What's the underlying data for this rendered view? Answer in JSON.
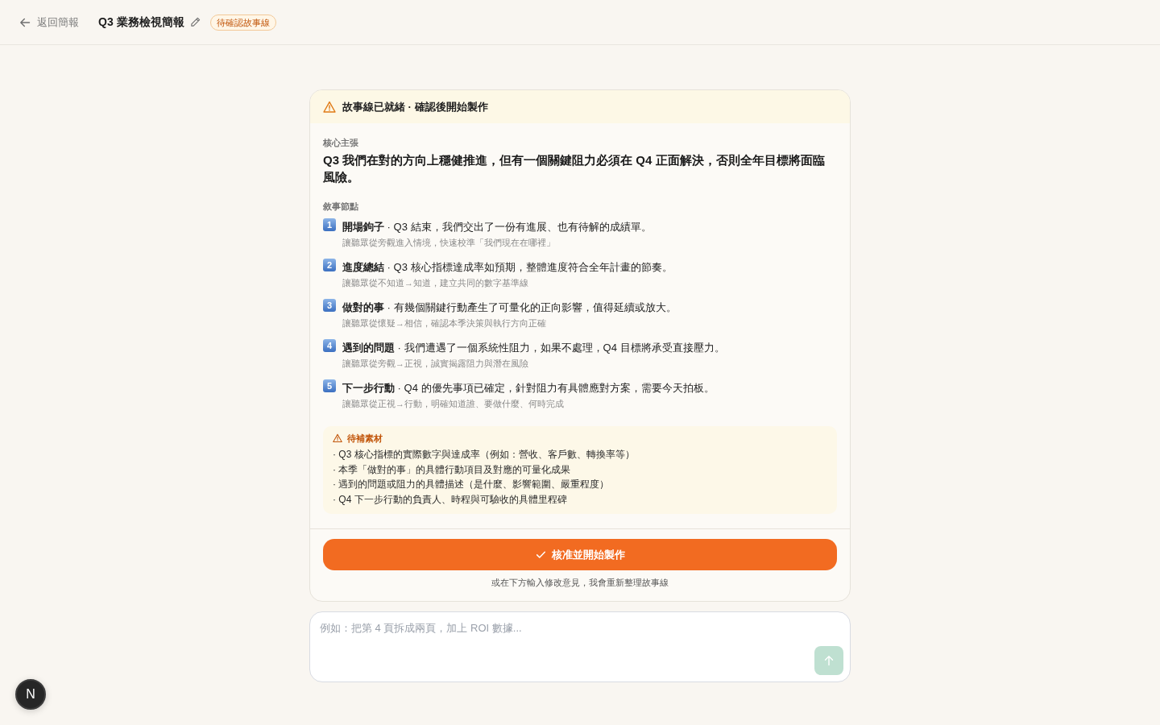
{
  "top_bar": {
    "back_link": "返回簡報",
    "title": "Q3 業務檢視簡報",
    "status_badge": "待確認故事線"
  },
  "storyline_card": {
    "banner": "故事線已就緒 · 確認後開始製作",
    "core_claim": {
      "label": "核心主張",
      "text": "Q3 我們在對的方向上穩健推進，但有一個關鍵阻力必須在 Q4 正面解決，否則全年目標將面臨風險。"
    },
    "narrative_nodes": {
      "label": "敘事節點",
      "items": [
        {
          "number": "1",
          "line": "**開場鉤子** · Q3 結束，我們交出了一份有進展、也有待解的成績單。",
          "goal": "讓聽眾從旁觀進入情境，快速校準「我們現在在哪裡」"
        },
        {
          "number": "2",
          "line": "**進度總結** · Q3 核心指標達成率如預期，整體進度符合全年計畫的節奏。",
          "goal": "讓聽眾從不知道→知道，建立共同的數字基準線"
        },
        {
          "number": "3",
          "line": "**做對的事** · 有幾個關鍵行動產生了可量化的正向影響，值得延續或放大。",
          "goal": "讓聽眾從懷疑→相信，確認本季決策與執行方向正確"
        },
        {
          "number": "4",
          "line": "**遇到的問題** · 我們遭遇了一個系統性阻力，如果不處理，Q4 目標將承受直接壓力。",
          "goal": "讓聽眾從旁觀→正視，誠實揭露阻力與潛在風險"
        },
        {
          "number": "5",
          "line": "**下一步行動** · Q4 的優先事項已確定，針對阻力有具體應對方案，需要今天拍板。",
          "goal": "讓聽眾從正視→行動，明確知道誰、要做什麼、何時完成"
        }
      ]
    },
    "missing_materials": {
      "title": "待補素材",
      "items": [
        "· Q3 核心指標的實際數字與達成率（例如：營收、客戶數、轉換率等）",
        "· 本季「做對的事」的具體行動項目及對應的可量化成果",
        "· 遇到的問題或阻力的具體描述（是什麼、影響範圍、嚴重程度）",
        "· Q4 下一步行動的負責人、時程與可驗收的具體里程碑"
      ]
    },
    "approve_button": "核准並開始製作",
    "hint": "或在下方輸入修改意見，我會重新整理故事線"
  },
  "composer": {
    "placeholder": "例如：把第 4 頁拆成兩頁，加上 ROI 數據...",
    "send_button": {
      "disabled": true
    }
  },
  "dev_indicator": {
    "label": "N"
  }
}
